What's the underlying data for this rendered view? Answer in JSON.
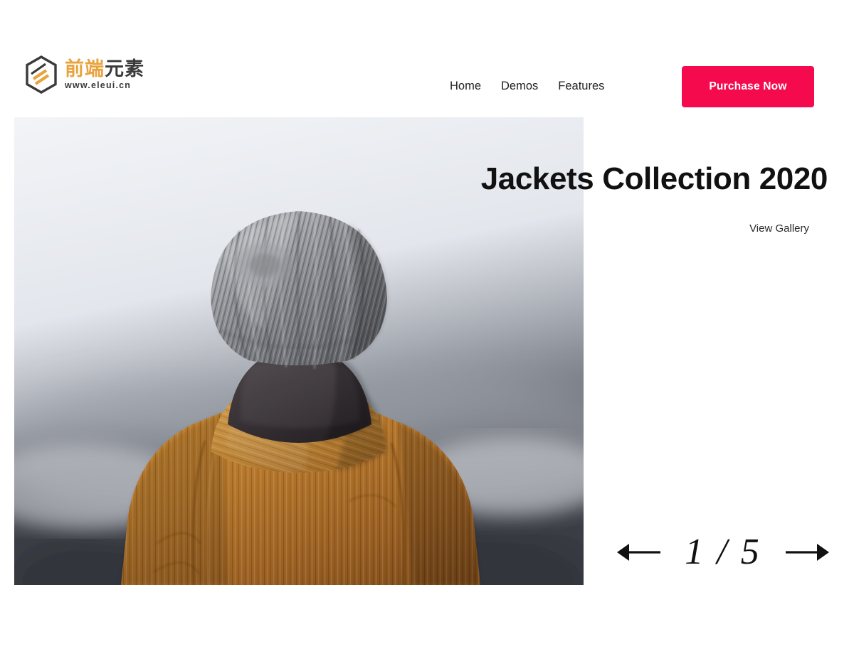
{
  "header": {
    "brand": {
      "name_cn_part1": "前端",
      "name_cn_part2": "元素",
      "url": "www.eleui.cn",
      "mark_icon": "hexagon-logo-icon",
      "color_orange": "#e8a33d",
      "color_dark": "#3a3a3a"
    },
    "nav": [
      {
        "label": "Home"
      },
      {
        "label": "Demos"
      },
      {
        "label": "Features"
      }
    ],
    "cta": {
      "label": "Purchase Now",
      "background": "#f50a4d",
      "color": "#ffffff"
    }
  },
  "hero": {
    "title": "Jackets Collection 2020",
    "gallery_link": "View Gallery",
    "photo": {
      "alt": "Person seen from behind wearing a gray knit beanie, dark scarf and tan corduroy hooded jacket, misty background",
      "icon": "hero-photo"
    }
  },
  "pager": {
    "prev_icon": "arrow-left-icon",
    "next_icon": "arrow-right-icon",
    "current": "1",
    "separator": "/",
    "total": "5",
    "count_label": "1 / 5"
  }
}
